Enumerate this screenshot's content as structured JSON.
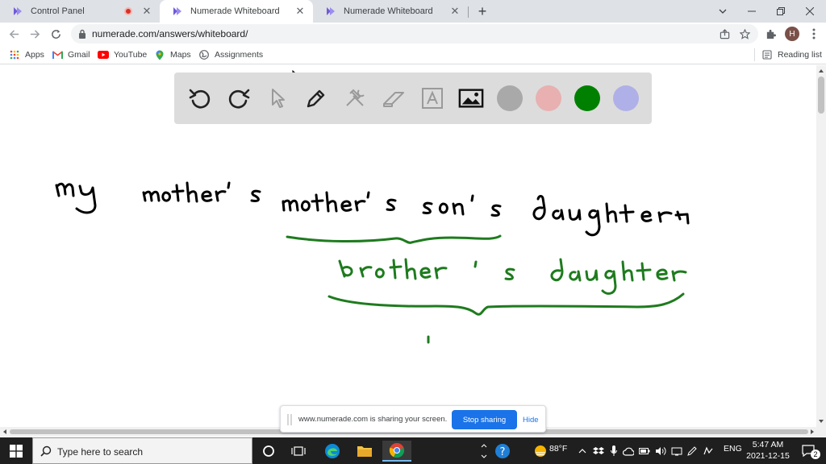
{
  "browser": {
    "tabs": [
      {
        "title": "Control Panel",
        "recording": true
      },
      {
        "title": "Numerade Whiteboard",
        "active": true
      },
      {
        "title": "Numerade Whiteboard"
      }
    ],
    "new_tab_symbol": "+",
    "url": "numerade.com/answers/whiteboard/",
    "profile_initial": "H"
  },
  "bookmarks": [
    {
      "label": "Apps",
      "icon": "apps-grid-icon"
    },
    {
      "label": "Gmail",
      "icon": "gmail-icon"
    },
    {
      "label": "YouTube",
      "icon": "youtube-icon"
    },
    {
      "label": "Maps",
      "icon": "maps-icon"
    },
    {
      "label": "Assignments",
      "icon": "globe-icon"
    }
  ],
  "reading_list": "Reading list",
  "whiteboard": {
    "tools": [
      "undo-icon",
      "redo-icon",
      "select-icon",
      "pen-icon",
      "tools-icon",
      "eraser-icon",
      "text-icon",
      "image-icon"
    ],
    "colors": [
      "#a9a9a9",
      "#e8b0b0",
      "#008000",
      "#b0b0e8"
    ],
    "ink_black": "#000000",
    "ink_green": "#1e7b1e",
    "handwriting": {
      "line1": [
        "My",
        "mother's",
        "mother's",
        "son's",
        "daughter"
      ],
      "line2": [
        "brother's",
        "daughter"
      ]
    }
  },
  "share_banner": {
    "message": "www.numerade.com is sharing your screen.",
    "stop_label": "Stop sharing",
    "hide_label": "Hide"
  },
  "taskbar": {
    "search_placeholder": "Type here to search",
    "weather": "88°F",
    "language": "ENG",
    "time": "5:47 AM",
    "date": "2021-12-15",
    "notification_count": "2"
  }
}
